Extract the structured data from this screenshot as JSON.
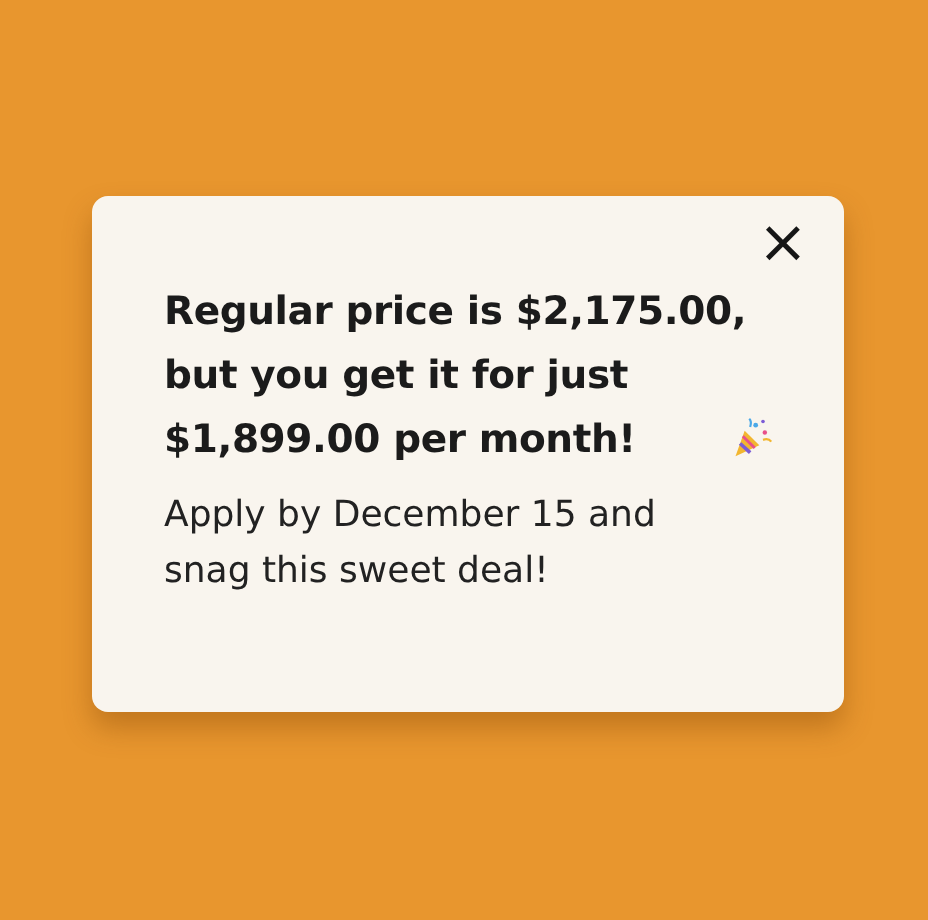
{
  "popup": {
    "close_button": "×",
    "headline_lines": [
      "Regular price is $2,175.00,",
      "but you get it for just",
      "$1,899.00 per month!"
    ],
    "body_lines": [
      "Apply by December 15 and",
      "snag this sweet deal!"
    ]
  }
}
